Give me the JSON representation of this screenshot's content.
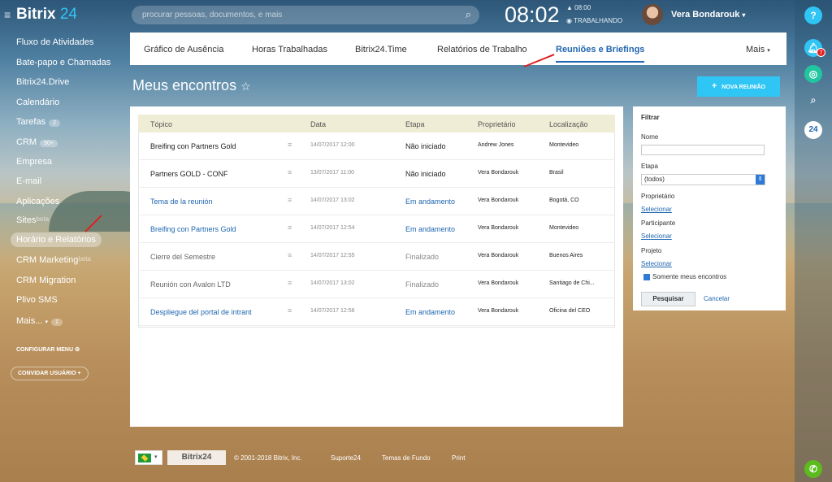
{
  "topbar": {
    "logo_a": "Bitrix",
    "logo_b": "24",
    "search_placeholder": "procurar pessoas, documentos, e mais",
    "clock": "08:02",
    "work_time": "▲ 08:00",
    "work_status": "◉ TRABALHANDO",
    "user_name": "Vera Bondarouk"
  },
  "menu": {
    "items": [
      "Fluxo de Atividades",
      "Bate-papo e Chamadas",
      "Bitrix24.Drive",
      "Calendário",
      "Tarefas",
      "CRM",
      "Empresa",
      "E-mail",
      "Aplicações",
      "Sites",
      "Horário e Relatórios",
      "CRM Marketing",
      "CRM Migration",
      "Plivo SMS",
      "Mais..."
    ],
    "tasks_badge": "2",
    "crm_badge": "50+",
    "more_badge": "1",
    "beta": "beta",
    "configure": "CONFIGURAR MENU",
    "invite": "CONVIDAR USUÁRIO"
  },
  "rail": {
    "help": "?",
    "notif_count": "7",
    "b24": "24"
  },
  "tabs": [
    "Gráfico de Ausência",
    "Horas Trabalhadas",
    "Bitrix24.Time",
    "Relatórios de Trabalho",
    "Reuniões e Briefings",
    "Mais"
  ],
  "page": {
    "title": "Meus encontros",
    "new_button": "NOVA REUNIÃO"
  },
  "grid": {
    "headers": [
      "Tópico",
      "Data",
      "Etapa",
      "Proprietário",
      "Localização"
    ],
    "rows": [
      [
        "Breifing con Partners Gold",
        "14/07/2017 12:00",
        "Não iniciado",
        "Andrew Jones",
        "Montevideo"
      ],
      [
        "Partners GOLD - CONF",
        "13/07/2017 11:00",
        "Não iniciado",
        "Vera Bondarouk",
        "Brasil"
      ],
      [
        "Tema de la reunión",
        "14/07/2017 13:02",
        "Em andamento",
        "Vera Bondarouk",
        "Bogotá, CO"
      ],
      [
        "Breifing con Partners Gold",
        "14/07/2017 12:54",
        "Em andamento",
        "Vera Bondarouk",
        "Montevideo"
      ],
      [
        "Cierre del Semestre",
        "14/07/2017 12:55",
        "Finalizado",
        "Vera Bondarouk",
        "Buenos Aires"
      ],
      [
        "Reunión con Avalon LTD",
        "14/07/2017 13:02",
        "Finalizado",
        "Vera Bondarouk",
        "Santiago de Chi..."
      ],
      [
        "Despliegue del portal de intrant",
        "14/07/2017 12:56",
        "Em andamento",
        "Vera Bondarouk",
        "Oficina del CEO"
      ]
    ]
  },
  "filter": {
    "title": "Filtrar",
    "name_label": "Nome",
    "stage_label": "Etapa",
    "stage_value": "(todos)",
    "owner_label": "Proprietário",
    "participant_label": "Participante",
    "project_label": "Projeto",
    "select": "Selecionar",
    "only_mine": "Somente meus encontros",
    "search_btn": "Pesquisar",
    "cancel": "Cancelar"
  },
  "footer": {
    "brand": "Bitrix24",
    "copyright": "© 2001-2018 Bitrix, Inc.",
    "support": "Suporte24",
    "themes": "Temas de Fundo",
    "print": "Print"
  },
  "colors": {
    "accent": "#2fc6f6",
    "link": "#2067b0",
    "arrow": "#e02020"
  }
}
